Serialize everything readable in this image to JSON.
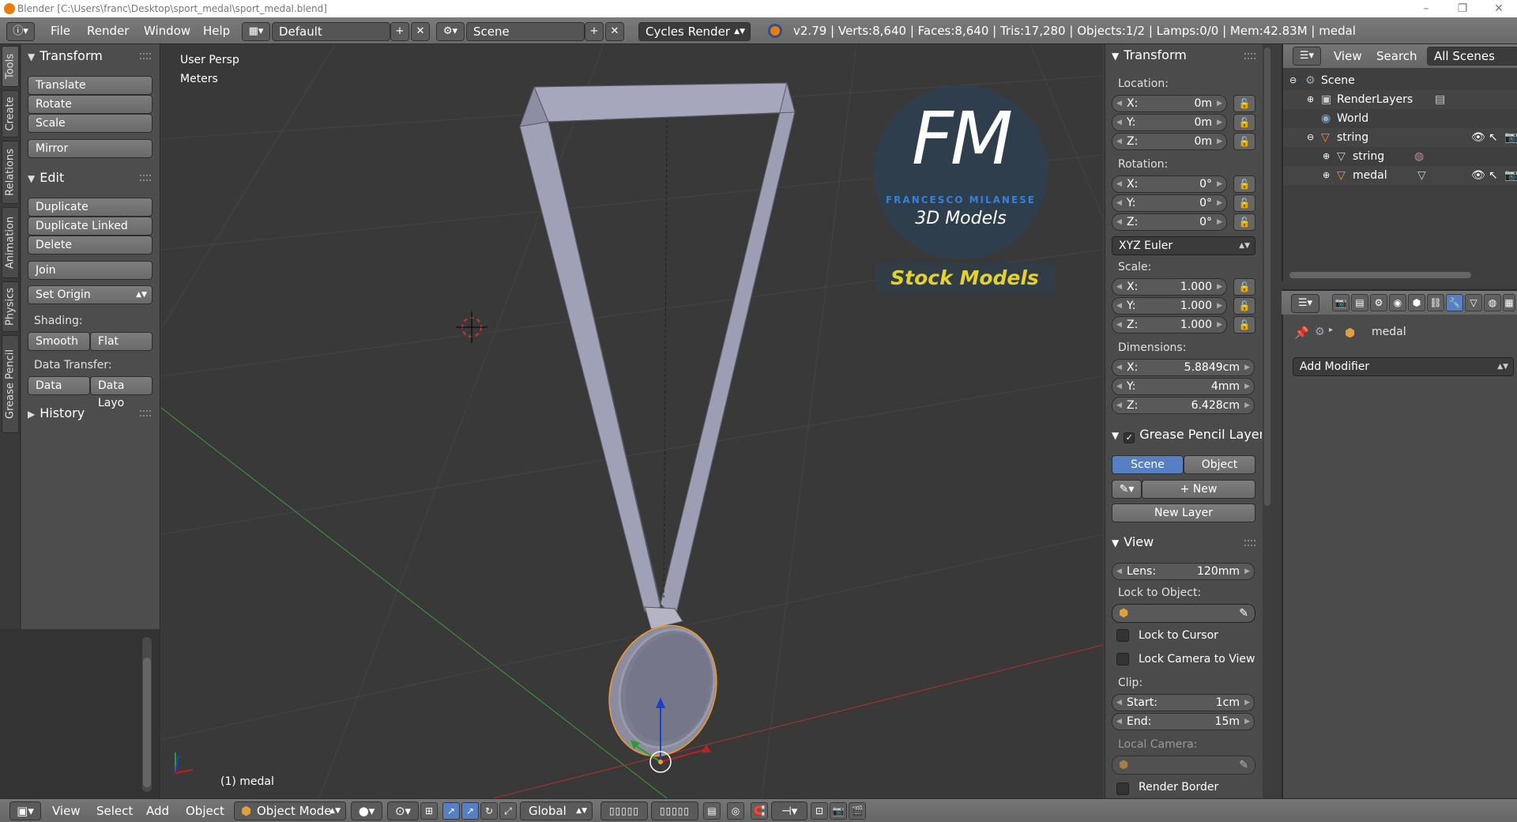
{
  "window": {
    "title": "Blender [C:\\Users\\franc\\Desktop\\sport_medal\\sport_medal.blend]",
    "controls": [
      "–",
      "❐",
      "✕"
    ]
  },
  "menu": [
    "File",
    "Render",
    "Window",
    "Help"
  ],
  "screen_layout": "Default",
  "scene_name": "Scene",
  "render_engine": "Cycles Render",
  "stats": "v2.79 | Verts:8,640 | Faces:8,640 | Tris:17,280 | Objects:1/2 | Lamps:0/0 | Mem:42.83M | medal",
  "left_tabs": [
    "Tools",
    "Create",
    "Relations",
    "Animation",
    "Physics",
    "Grease Pencil"
  ],
  "tool_shelf": {
    "transform_header": "Transform",
    "transform_buttons": [
      "Translate",
      "Rotate",
      "Scale",
      "Mirror"
    ],
    "edit_header": "Edit",
    "edit_buttons": [
      "Duplicate",
      "Duplicate Linked",
      "Delete",
      "Join"
    ],
    "set_origin": "Set Origin",
    "shading_label": "Shading:",
    "smooth": "Smooth",
    "flat": "Flat",
    "data_transfer_label": "Data Transfer:",
    "data": "Data",
    "data_layout": "Data Layo",
    "history_header": "History"
  },
  "viewport": {
    "view_name": "User Persp",
    "units": "Meters",
    "object_label": "(1) medal",
    "watermark": {
      "initials": "FM",
      "name": "FRANCESCO MILANESE",
      "tagline": "3D Models",
      "banner": "Stock Models"
    }
  },
  "bottom_header": {
    "menus": [
      "View",
      "Select",
      "Add",
      "Object"
    ],
    "mode": "Object Mode",
    "orientation": "Global"
  },
  "properties_panel": {
    "transform_header": "Transform",
    "location_label": "Location:",
    "location": [
      {
        "axis": "X:",
        "value": "0m"
      },
      {
        "axis": "Y:",
        "value": "0m"
      },
      {
        "axis": "Z:",
        "value": "0m"
      }
    ],
    "rotation_label": "Rotation:",
    "rotation": [
      {
        "axis": "X:",
        "value": "0°"
      },
      {
        "axis": "Y:",
        "value": "0°"
      },
      {
        "axis": "Z:",
        "value": "0°"
      }
    ],
    "rotation_mode": "XYZ Euler",
    "scale_label": "Scale:",
    "scale": [
      {
        "axis": "X:",
        "value": "1.000"
      },
      {
        "axis": "Y:",
        "value": "1.000"
      },
      {
        "axis": "Z:",
        "value": "1.000"
      }
    ],
    "dimensions_label": "Dimensions:",
    "dimensions": [
      {
        "axis": "X:",
        "value": "5.8849cm"
      },
      {
        "axis": "Y:",
        "value": "4mm"
      },
      {
        "axis": "Z:",
        "value": "6.428cm"
      }
    ],
    "grease_pencil_header": "Grease Pencil Layer",
    "gp_scene": "Scene",
    "gp_object": "Object",
    "gp_new": "New",
    "gp_new_layer": "New Layer",
    "view_header": "View",
    "lens_label": "Lens:",
    "lens_value": "120mm",
    "lock_to_object_label": "Lock to Object:",
    "lock_to_cursor": "Lock to Cursor",
    "lock_camera_to_view": "Lock Camera to View",
    "clip_label": "Clip:",
    "clip_start_label": "Start:",
    "clip_start": "1cm",
    "clip_end_label": "End:",
    "clip_end": "15m",
    "local_camera_label": "Local Camera:",
    "render_border": "Render Border"
  },
  "outliner": {
    "header": {
      "view": "View",
      "search": "Search",
      "filter": "All Scenes"
    },
    "rows": [
      {
        "label": "Scene"
      },
      {
        "label": "RenderLayers"
      },
      {
        "label": "World"
      },
      {
        "label": "string"
      },
      {
        "label": "string"
      },
      {
        "label": "medal"
      }
    ]
  },
  "properties_editor": {
    "context_object": "medal",
    "add_modifier": "Add Modifier"
  },
  "colors": {
    "accent": "#5680c2",
    "selection_orange": "#f39a25",
    "x_axis": "#b03030",
    "y_axis": "#3f9b3f",
    "watermark_yellow": "#e4d22a",
    "watermark_blue": "#3a7fd6"
  }
}
